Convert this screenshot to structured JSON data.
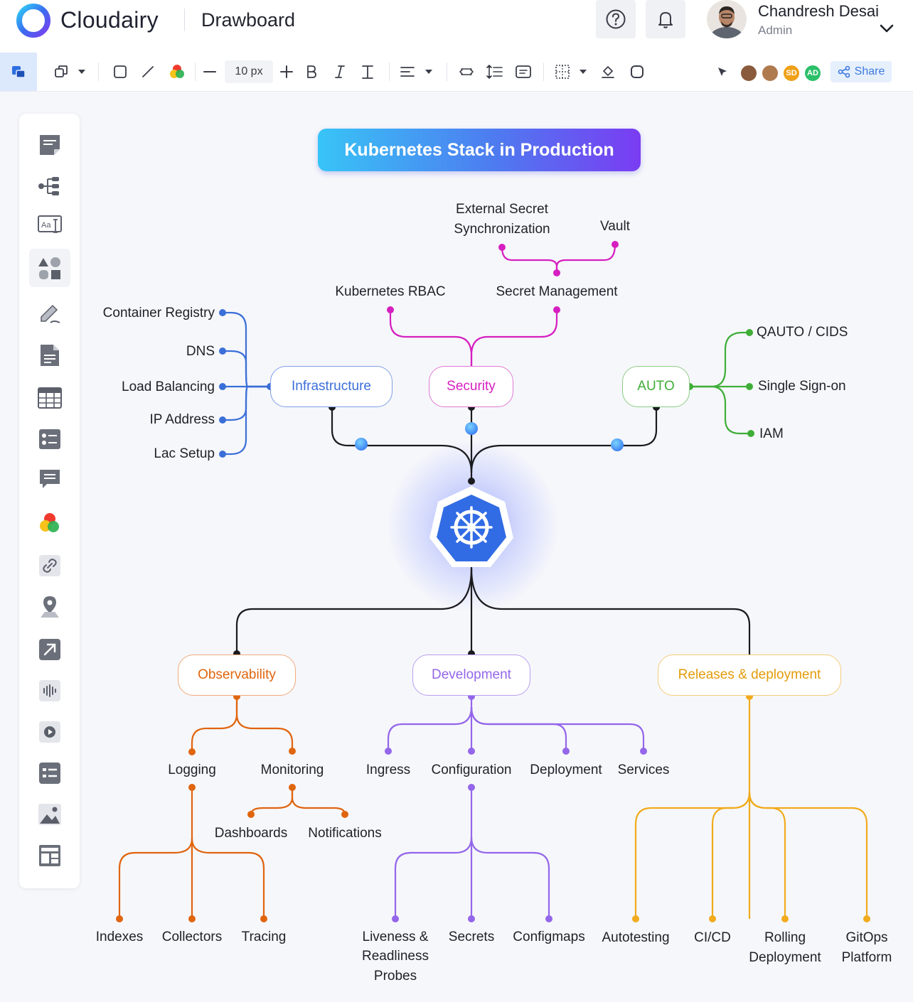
{
  "app": {
    "brand": "Cloudairy",
    "title": "Drawboard"
  },
  "user": {
    "name": "Chandresh Desai",
    "role": "Admin"
  },
  "toolbar": {
    "font_size": "10 px",
    "share_label": "Share",
    "collaborators": [
      {
        "initials": "",
        "color": "#8a5a3c"
      },
      {
        "initials": "",
        "color": "#b07a4f"
      },
      {
        "initials": "SD",
        "color": "#f0a019"
      },
      {
        "initials": "AD",
        "color": "#2bbf6a"
      }
    ]
  },
  "diagram": {
    "title": "Kubernetes Stack in Production",
    "categories": {
      "infrastructure": "Infrastructure",
      "security": "Security",
      "auto": "AUTO",
      "observability": "Observability",
      "development": "Development",
      "releases": "Releases & deployment"
    },
    "infrastructure_items": [
      "Container Registry",
      "DNS",
      "Load Balancing",
      "IP Address",
      "Lac Setup"
    ],
    "security_items": {
      "rbac": "Kubernetes RBAC",
      "secret_mgmt": "Secret Management",
      "ext_secret_line1": "External Secret",
      "ext_secret_line2": "Synchronization",
      "vault": "Vault"
    },
    "auto_items": [
      "QAUTO / CIDS",
      "Single Sign-on",
      "IAM"
    ],
    "observability_items": {
      "logging": "Logging",
      "monitoring": "Monitoring",
      "dashboards": "Dashboards",
      "notifications": "Notifications",
      "indexes": "Indexes",
      "collectors": "Collectors",
      "tracing": "Tracing"
    },
    "development_items": {
      "ingress": "Ingress",
      "configuration": "Configuration",
      "deployment": "Deployment",
      "services": "Services",
      "liveness_line1": "Liveness &",
      "liveness_line2": "Readliness",
      "liveness_line3": "Probes",
      "secrets": "Secrets",
      "configmaps": "Configmaps"
    },
    "release_items": {
      "autotesting": "Autotesting",
      "cicd": "CI/CD",
      "rolling_line1": "Rolling",
      "rolling_line2": "Deployment",
      "gitops_line1": "GitOps",
      "gitops_line2": "Platform"
    },
    "colors": {
      "infrastructure": "#3b6fd8",
      "security": "#d61fc0",
      "auto": "#3fae38",
      "observability": "#e0650f",
      "development": "#9466ea",
      "releases": "#f1ab1d",
      "trunk": "#1b1b1f"
    }
  }
}
